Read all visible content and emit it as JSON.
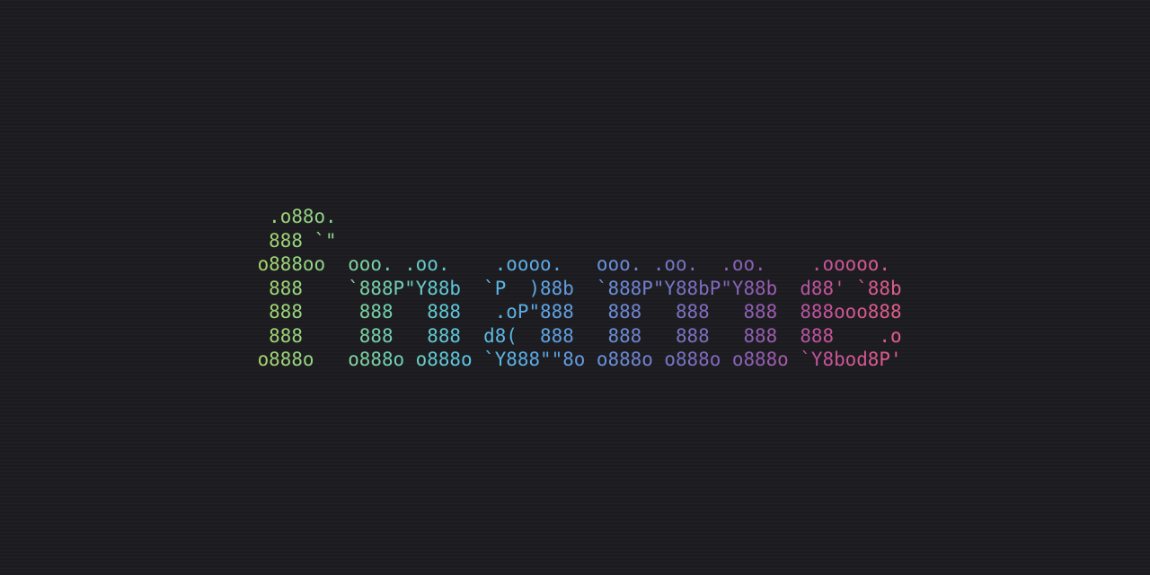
{
  "ascii_art": {
    "lines": [
      "  .o88o.",
      "  888 `\"",
      " o888oo  ooo. .oo.    .oooo.   ooo. .oo.  .oo.    .ooooo.",
      "  888    `888P\"Y88b  `P  )88b  `888P\"Y88bP\"Y88b  d88' `88b",
      "  888     888   888   .oP\"888   888   888   888  888ooo888",
      "  888     888   888  d8(  888   888   888   888  888    .o",
      " o888o   o888o o888o `Y888\"\"8o o888o o888o o888o `Y8bod8P'"
    ],
    "gradient_colors": [
      "#a8d36a",
      "#8fd48a",
      "#6fcfb4",
      "#5bc3e3",
      "#5da8e6",
      "#6a8fd8",
      "#7a72c4",
      "#8d5fb4",
      "#c5529a",
      "#e05e8c"
    ]
  }
}
